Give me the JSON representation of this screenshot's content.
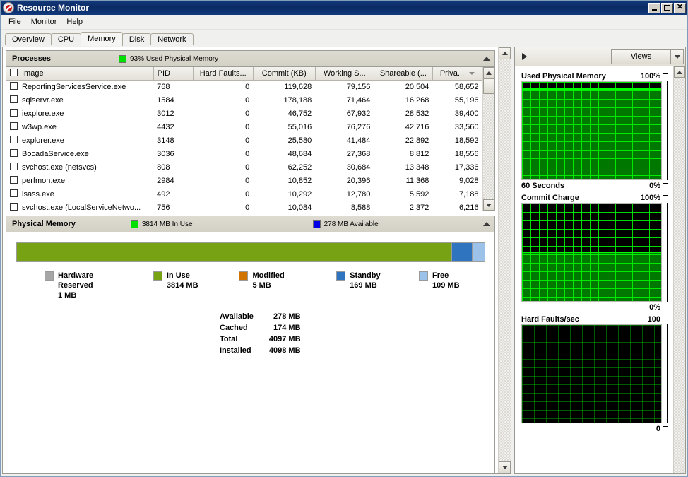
{
  "window": {
    "title": "Resource Monitor",
    "icon": "resource-monitor-icon",
    "minimize_label": "",
    "maximize_label": "",
    "close_label": "✕"
  },
  "menu": {
    "items": [
      {
        "label": "File"
      },
      {
        "label": "Monitor"
      },
      {
        "label": "Help"
      }
    ]
  },
  "tabs": {
    "items": [
      {
        "label": "Overview",
        "active": false
      },
      {
        "label": "CPU",
        "active": false
      },
      {
        "label": "Memory",
        "active": true
      },
      {
        "label": "Disk",
        "active": false
      },
      {
        "label": "Network",
        "active": false
      }
    ]
  },
  "processes_section": {
    "title": "Processes",
    "legend": {
      "swatch_color": "#00e000",
      "label": "93% Used Physical Memory"
    },
    "collapse_icon": "triangle-up-icon",
    "columns": [
      {
        "label": "Image",
        "key": "image",
        "align": "left",
        "sorted": false
      },
      {
        "label": "PID",
        "key": "pid",
        "align": "left",
        "sorted": false
      },
      {
        "label": "Hard Faults...",
        "key": "hard_faults",
        "align": "right",
        "sorted": false
      },
      {
        "label": "Commit (KB)",
        "key": "commit",
        "align": "right",
        "sorted": false
      },
      {
        "label": "Working S...",
        "key": "working_set",
        "align": "right",
        "sorted": false
      },
      {
        "label": "Shareable (...",
        "key": "shareable",
        "align": "right",
        "sorted": false
      },
      {
        "label": "Priva...",
        "key": "private",
        "align": "right",
        "sorted": true
      }
    ],
    "rows": [
      {
        "image": "ReportingServicesService.exe",
        "pid": "768",
        "hard_faults": "0",
        "commit": "119,628",
        "working_set": "79,156",
        "shareable": "20,504",
        "private": "58,652"
      },
      {
        "image": "sqlservr.exe",
        "pid": "1584",
        "hard_faults": "0",
        "commit": "178,188",
        "working_set": "71,464",
        "shareable": "16,268",
        "private": "55,196"
      },
      {
        "image": "iexplore.exe",
        "pid": "3012",
        "hard_faults": "0",
        "commit": "46,752",
        "working_set": "67,932",
        "shareable": "28,532",
        "private": "39,400"
      },
      {
        "image": "w3wp.exe",
        "pid": "4432",
        "hard_faults": "0",
        "commit": "55,016",
        "working_set": "76,276",
        "shareable": "42,716",
        "private": "33,560"
      },
      {
        "image": "explorer.exe",
        "pid": "3148",
        "hard_faults": "0",
        "commit": "25,580",
        "working_set": "41,484",
        "shareable": "22,892",
        "private": "18,592"
      },
      {
        "image": "BocadaService.exe",
        "pid": "3036",
        "hard_faults": "0",
        "commit": "48,684",
        "working_set": "27,368",
        "shareable": "8,812",
        "private": "18,556"
      },
      {
        "image": "svchost.exe (netsvcs)",
        "pid": "808",
        "hard_faults": "0",
        "commit": "62,252",
        "working_set": "30,684",
        "shareable": "13,348",
        "private": "17,336"
      },
      {
        "image": "perfmon.exe",
        "pid": "2984",
        "hard_faults": "0",
        "commit": "10,852",
        "working_set": "20,396",
        "shareable": "11,368",
        "private": "9,028"
      },
      {
        "image": "lsass.exe",
        "pid": "492",
        "hard_faults": "0",
        "commit": "10,292",
        "working_set": "12,780",
        "shareable": "5,592",
        "private": "7,188"
      },
      {
        "image": "svchost.exe (LocalServiceNetwo...",
        "pid": "756",
        "hard_faults": "0",
        "commit": "10,084",
        "working_set": "8,588",
        "shareable": "2,372",
        "private": "6,216"
      }
    ]
  },
  "physical_memory_section": {
    "title": "Physical Memory",
    "legends": [
      {
        "swatch_color": "#00e000",
        "label": "3814 MB In Use"
      },
      {
        "swatch_color": "#0000e6",
        "label": "278 MB Available"
      }
    ],
    "collapse_icon": "triangle-up-icon",
    "bar_segments": [
      {
        "name": "in-use",
        "color": "#76a214",
        "percent": 93.1
      },
      {
        "name": "standby",
        "color": "#2f74bf",
        "percent": 4.2
      },
      {
        "name": "free",
        "color": "#9cc2ea",
        "percent": 2.7
      }
    ],
    "legend_items": [
      {
        "name": "hardware-reserved",
        "color": "#a6a6a6",
        "label": "Hardware\nReserved",
        "line1": "Hardware",
        "line2": "Reserved",
        "value": "1 MB"
      },
      {
        "name": "in-use",
        "color": "#76a214",
        "line1": "In Use",
        "line2": "",
        "value": "3814 MB"
      },
      {
        "name": "modified",
        "color": "#d07300",
        "line1": "Modified",
        "line2": "",
        "value": "5 MB"
      },
      {
        "name": "standby",
        "color": "#2f74bf",
        "line1": "Standby",
        "line2": "",
        "value": "169 MB"
      },
      {
        "name": "free",
        "color": "#9cc2ea",
        "line1": "Free",
        "line2": "",
        "value": "109 MB"
      }
    ],
    "totals": [
      {
        "label": "Available",
        "value": "278 MB"
      },
      {
        "label": "Cached",
        "value": "174 MB"
      },
      {
        "label": "Total",
        "value": "4097 MB"
      },
      {
        "label": "Installed",
        "value": "4098 MB"
      }
    ]
  },
  "right_panel": {
    "expand_icon": "triangle-right-icon",
    "views_label": "Views",
    "views_dropdown_icon": "chevron-down-icon",
    "graphs": [
      {
        "name": "used-physical-memory-graph",
        "title": "Used Physical Memory",
        "top_label": "100%",
        "bottom_left_label": "60 Seconds",
        "bottom_right_label": "0%",
        "fill_percent": 93,
        "grid": "bright"
      },
      {
        "name": "commit-charge-graph",
        "title": "Commit Charge",
        "top_label": "100%",
        "bottom_left_label": "",
        "bottom_right_label": "0%",
        "fill_percent": 50,
        "grid": "bright"
      },
      {
        "name": "hard-faults-graph",
        "title": "Hard Faults/sec",
        "top_label": "100",
        "bottom_left_label": "",
        "bottom_right_label": "0",
        "fill_percent": 0,
        "grid": "dim"
      }
    ]
  },
  "chart_data": [
    {
      "type": "area",
      "title": "Used Physical Memory",
      "ylabel": "%",
      "xlabel": "60 Seconds",
      "ylim": [
        0,
        100
      ],
      "current_value": 93,
      "values": [
        93,
        93,
        93,
        93,
        93,
        93,
        93,
        93,
        93,
        93,
        93,
        93
      ],
      "grid": true
    },
    {
      "type": "area",
      "title": "Commit Charge",
      "ylabel": "%",
      "xlabel": "",
      "ylim": [
        0,
        100
      ],
      "current_value": 50,
      "values": [
        50,
        50,
        50,
        50,
        50,
        50,
        50,
        50,
        50,
        50,
        50,
        50
      ],
      "grid": true
    },
    {
      "type": "area",
      "title": "Hard Faults/sec",
      "ylabel": "",
      "xlabel": "",
      "ylim": [
        0,
        100
      ],
      "current_value": 0,
      "values": [
        0,
        0,
        0,
        0,
        0,
        0,
        0,
        0,
        0,
        0,
        0,
        0
      ],
      "grid": true
    },
    {
      "type": "bar",
      "title": "Physical Memory Breakdown",
      "categories": [
        "Hardware Reserved",
        "In Use",
        "Modified",
        "Standby",
        "Free"
      ],
      "values": [
        1,
        3814,
        5,
        169,
        109
      ],
      "ylabel": "MB",
      "xlabel": ""
    }
  ]
}
